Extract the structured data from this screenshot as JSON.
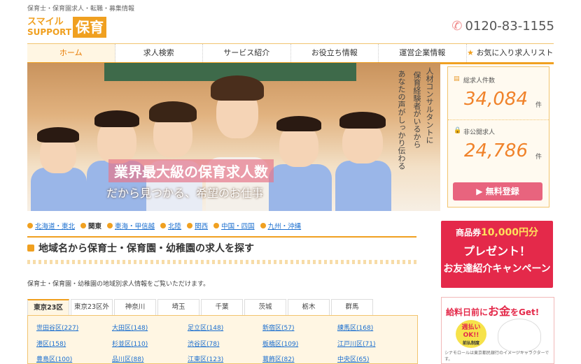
{
  "header": {
    "tagline": "保育士・保育園求人・転職・募集情報",
    "logo_line1": "スマイル",
    "logo_line2": "SUPPORT",
    "logo_box": "保育",
    "phone": "0120-83-1155"
  },
  "nav": {
    "items": [
      "ホーム",
      "求人検索",
      "サービス紹介",
      "お役立ち情報",
      "運営企業情報",
      "お気に入り求人リスト"
    ],
    "active": "ホーム"
  },
  "hero": {
    "title": "業界最大級の保育求人数",
    "subtitle": "だから見つかる、希望のお仕事",
    "vertical_1": "人材コンサルタントに",
    "vertical_2": "保育経験者がいるから",
    "vertical_3": "あなたの声がしっかり伝わる"
  },
  "stats": {
    "total_label": "総求人件数",
    "total_value": "34,084",
    "private_label": "非公開求人",
    "private_value": "24,786",
    "unit": "件",
    "register_label": "無料登録"
  },
  "regions": [
    "北海道・東北",
    "関東",
    "東海・甲信越",
    "北陸",
    "関西",
    "中国・四国",
    "九州・沖縄"
  ],
  "section": {
    "title": "地域名から保育士・保育園・幼稚園の求人を探す",
    "description": "保育士・保育園・幼稚園の地域別求人情報をご覧いただけます。"
  },
  "tabs": [
    "東京23区",
    "東京23区外",
    "神奈川",
    "埼玉",
    "千葉",
    "茨城",
    "栃木",
    "群馬"
  ],
  "wards": [
    [
      "世田谷区(227)",
      "大田区(148)",
      "足立区(148)",
      "新宿区(57)",
      "練馬区(168)"
    ],
    [
      "港区(158)",
      "杉並区(110)",
      "渋谷区(78)",
      "板橋区(109)",
      "江戸川区(71)"
    ],
    [
      "豊島区(100)",
      "品川区(88)",
      "江東区(123)",
      "葛飾区(82)",
      "中央区(65)"
    ]
  ],
  "ads": {
    "ad1_top_pre": "商品券",
    "ad1_top_num": "10,000円分",
    "ad1_mid": "プレゼント！",
    "ad1_bot": "お友達紹介キャンペーン",
    "ad2_pre": "給料日前に",
    "ad2_big": "お金",
    "ad2_post": "をGet!",
    "ad2_badge_1": "週払い",
    "ad2_badge_2": "OK!!",
    "ad2_badge_3": "前払制度",
    "ad2_note": "シナモロールは東京都民銀行のイメージキャラクターです。"
  },
  "colors": {
    "accent": "#f0a020",
    "link": "#1a6ecf",
    "register": "#e8647e",
    "ad_red": "#e4294a"
  }
}
